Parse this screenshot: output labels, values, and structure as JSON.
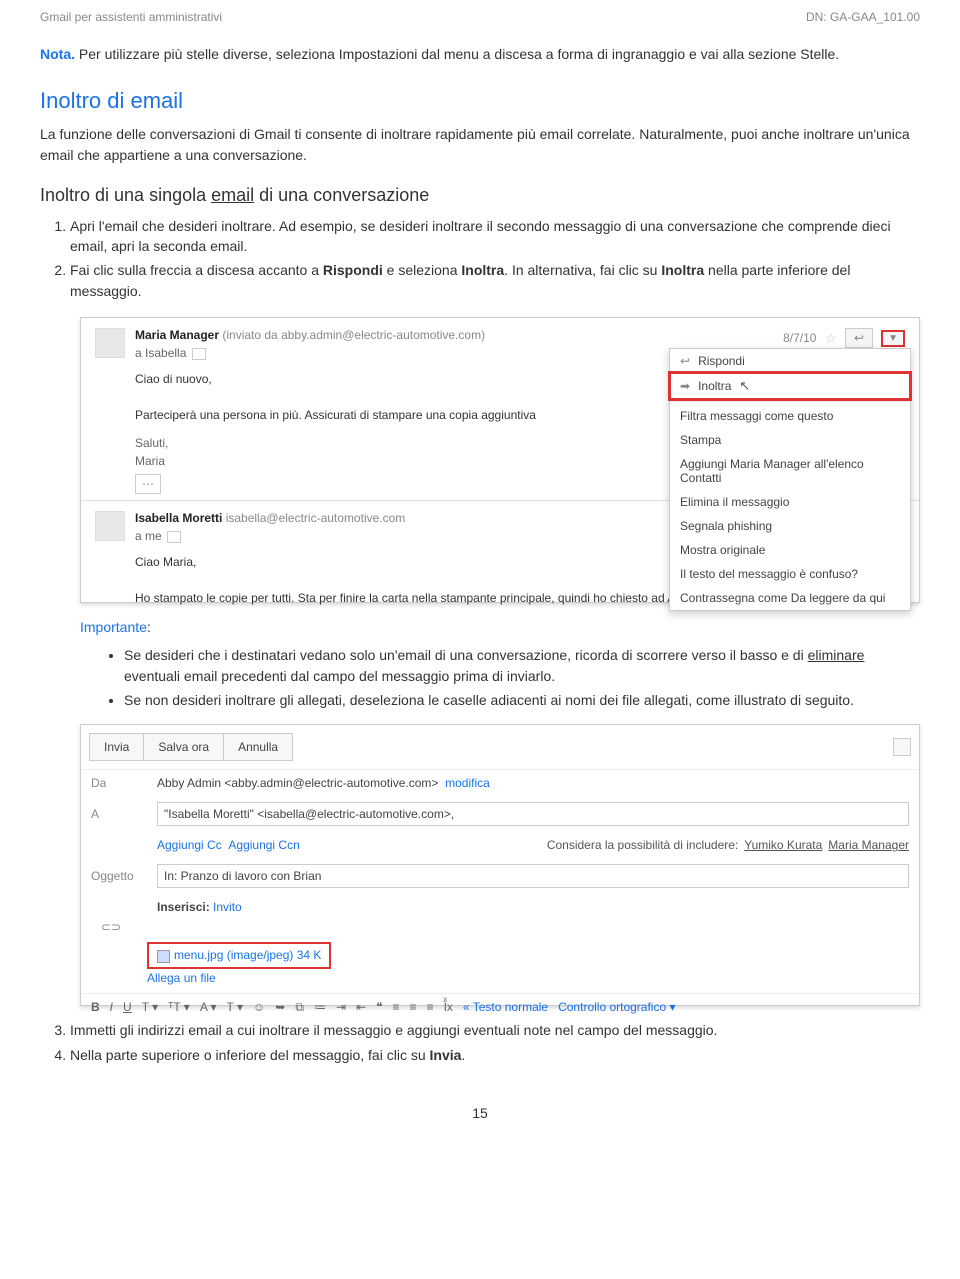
{
  "header": {
    "left": "Gmail per assistenti amministrativi",
    "right": "DN: GA-GAA_101.00"
  },
  "note": {
    "label": "Nota.",
    "text": " Per utilizzare più stelle diverse, seleziona Impostazioni dal menu a discesa a forma di ingranaggio e vai alla sezione Stelle."
  },
  "h2": "Inoltro di email",
  "p1": "La funzione delle conversazioni di Gmail ti consente di inoltrare rapidamente più email correlate. Naturalmente, puoi anche inoltrare un'unica email che appartiene a una conversazione.",
  "h3a": "Inoltro di una singola ",
  "h3u": "email",
  "h3b": " di una conversazione",
  "ol1": [
    "Apri l'email che desideri inoltrare. Ad esempio, se desideri inoltrare il secondo messaggio di una conversazione che comprende dieci email, apri la seconda email.",
    "Fai clic sulla freccia a discesa accanto a Rispondi e seleziona Inoltra. In alternativa, fai clic su Inoltra nella parte inferiore del messaggio."
  ],
  "shot1": {
    "from": "Maria Manager",
    "fromDetail": " (inviato da abby.admin@electric-automotive.com)",
    "to": "a Isabella",
    "date": "8/7/10",
    "body1": "Ciao di nuovo,",
    "body2": "Parteciperà una persona in più. Assicurati di stampare una copia aggiuntiva",
    "sig1": "Saluti,",
    "sig2": "Maria",
    "menu": [
      "Rispondi",
      "Inoltra",
      "Filtra messaggi come questo",
      "Stampa",
      "Aggiungi Maria Manager all'elenco Contatti",
      "Elimina il messaggio",
      "Segnala phishing",
      "Mostra originale",
      "Il testo del messaggio è confuso?",
      "Contrassegna come Da leggere da qui"
    ],
    "from2": "Isabella Moretti",
    "email2": "isabella@electric-automotive.com",
    "to2": "a me",
    "body3": "Ciao Maria,",
    "body4": "Ho stampato le copie per tutti. Sta per finire la carta nella stampante principale, quindi ho chiesto ad Abby di ordinarla. Sto cercando"
  },
  "important": {
    "label": "Importante",
    "colon": ":",
    "items": [
      {
        "a": "Se desideri che i destinatari vedano solo un'email di una conversazione, ricorda di scorrere verso il basso e di ",
        "u": "eliminare",
        "b": " eventuali email precedenti dal campo del messaggio prima di inviarlo."
      },
      {
        "a": "Se non desideri inoltrare gli allegati, deseleziona le caselle adiacenti ai nomi dei file allegati, come illustrato di seguito.",
        "u": "",
        "b": ""
      }
    ]
  },
  "shot2": {
    "btns": [
      "Invia",
      "Salva ora",
      "Annulla"
    ],
    "da": "Da",
    "daVal": "Abby Admin <abby.admin@electric-automotive.com>",
    "mod": "modifica",
    "a": "A",
    "aVal": "\"Isabella Moretti\" <isabella@electric-automotive.com>,",
    "cc": "Aggiungi Cc",
    "ccn": "Aggiungi Ccn",
    "sug": "Considera la possibilità di includere:",
    "s1": "Yumiko Kurata",
    "s2": "Maria Manager",
    "ogg": "Oggetto",
    "oggVal": "In: Pranzo di lavoro con Brian",
    "ins": "Inserisci:",
    "inv": "Invito",
    "att": "menu.jpg (image/jpeg) 34 K",
    "attl": "Allega un file",
    "fmt": [
      "B",
      "I",
      "U",
      "T ▾",
      "ᵀT ▾",
      "A ▾",
      "T ▾",
      "☺",
      "➥",
      "⧉",
      "≔",
      "≔",
      "⇥",
      "⇤",
      "❝",
      "≡",
      "≡",
      "≡",
      "Iͯx"
    ],
    "tn": "« Testo normale",
    "sp": "Controllo ortografico ▾"
  },
  "ol2": [
    "Immetti gli indirizzi email a cui inoltrare il messaggio e aggiungi eventuali note nel campo del messaggio.",
    "Nella parte superiore o inferiore del messaggio, fai clic su Invia."
  ],
  "pagenum": "15"
}
